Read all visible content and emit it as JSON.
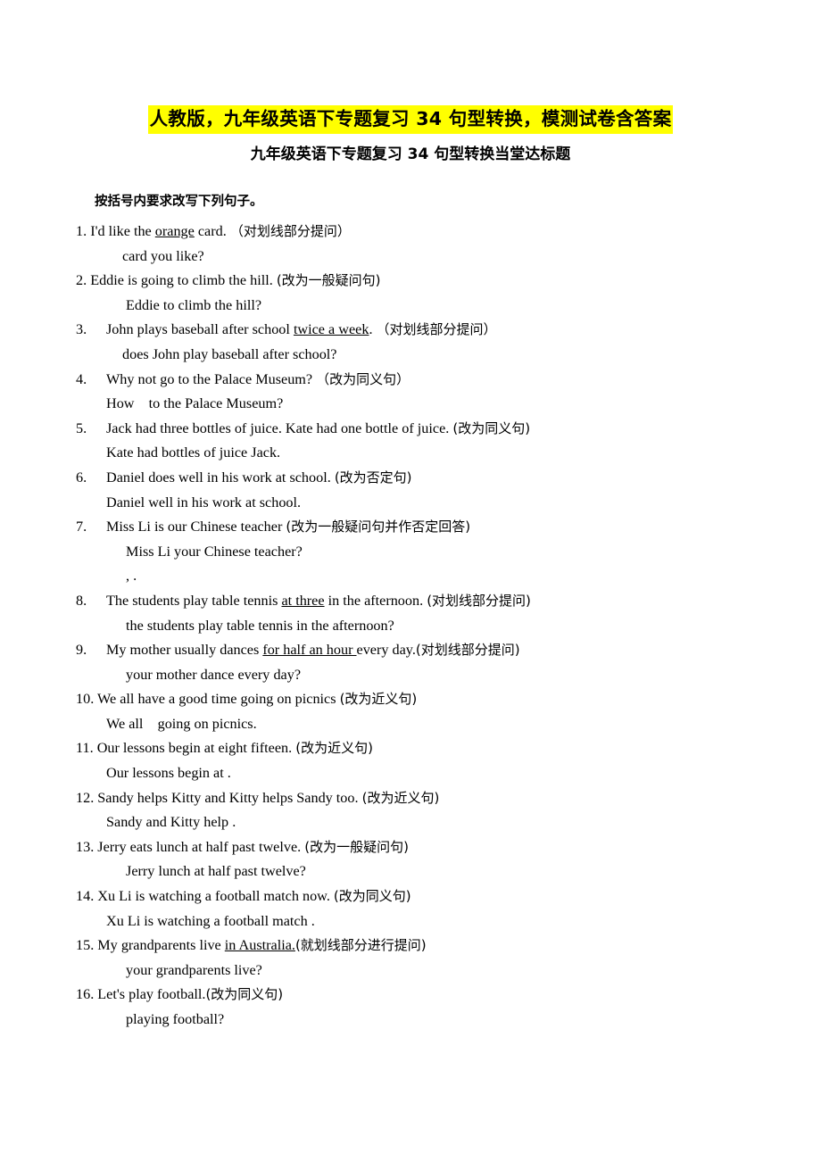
{
  "document": {
    "title": "人教版，九年级英语下专题复习 34 句型转换，模测试卷含答案",
    "title_highlight_color": "#ffff00",
    "subtitle": "九年级英语下专题复习 34 句型转换当堂达标题",
    "instruction": "按括号内要求改写下列句子。"
  },
  "questions": [
    {
      "number": "1.",
      "stem_pre": "I'd like the ",
      "stem_underlined": "orange",
      "stem_post": " card.",
      "stem_note": "（对划线部分提问）",
      "answer_parts": [
        "",
        "card",
        "you like?"
      ]
    },
    {
      "number": "2.",
      "stem_pre": "Eddie is going to climb the hill.",
      "stem_underlined": "",
      "stem_post": "",
      "stem_note": "(改为一般疑问句)",
      "answer_parts": [
        "Eddie",
        "to climb the hill?"
      ]
    },
    {
      "number": "3.",
      "stem_pre": "John plays baseball after school ",
      "stem_underlined": "twice a week",
      "stem_post": ".",
      "stem_note": "（对划线部分提问）",
      "answer_parts": [
        "does John play baseball after school?"
      ]
    },
    {
      "number": "4.",
      "stem_pre": "Why not go to the Palace Museum?",
      "stem_underlined": "",
      "stem_post": "",
      "stem_note": "（改为同义句）",
      "answer_parts": [
        "How",
        "to the Palace Museum?"
      ]
    },
    {
      "number": "5.",
      "stem_pre": "Jack had three bottles of juice. Kate had one bottle of juice.",
      "stem_underlined": "",
      "stem_post": "",
      "stem_note": "(改为同义句)",
      "answer_parts": [
        "Kate had",
        "bottles of juice",
        "Jack."
      ]
    },
    {
      "number": "6.",
      "stem_pre": "Daniel does well in his work at school.",
      "stem_underlined": "",
      "stem_post": "",
      "stem_note": "(改为否定句)",
      "answer_parts": [
        "Daniel",
        "well in his work at school."
      ]
    },
    {
      "number": "7.",
      "stem_pre": "Miss Li is our Chinese teacher ",
      "stem_underlined": "",
      "stem_post": "",
      "stem_note": "(改为一般疑问句并作否定回答)",
      "answer_parts": [
        "Miss Li your Chinese teacher?",
        ", ."
      ]
    },
    {
      "number": "8.",
      "stem_pre": "The students play table tennis ",
      "stem_underlined": "at three",
      "stem_post": " in the afternoon.",
      "stem_note": "(对划线部分提问)",
      "answer_parts": [
        "the students play table tennis in the afternoon?"
      ]
    },
    {
      "number": "9.",
      "stem_pre": "My mother usually dances ",
      "stem_underlined": "for half an hour ",
      "stem_post": "every day.",
      "stem_note": "(对划线部分提问)",
      "answer_parts": [
        "your mother dance every day?"
      ]
    },
    {
      "number": "10.",
      "stem_pre": "We all have a good time going on picnics ",
      "stem_underlined": "",
      "stem_post": "",
      "stem_note": "(改为近义句)",
      "answer_parts": [
        "We all",
        "going on picnics."
      ]
    },
    {
      "number": "11.",
      "stem_pre": "Our lessons begin at eight fifteen.",
      "stem_underlined": "",
      "stem_post": "",
      "stem_note": "(改为近义句)",
      "answer_parts": [
        "Our lessons begin at",
        "."
      ]
    },
    {
      "number": "12.",
      "stem_pre": "Sandy helps Kitty and Kitty helps Sandy too.",
      "stem_underlined": "",
      "stem_post": "",
      "stem_note": "(改为近义句)",
      "answer_parts": [
        "Sandy and Kitty help",
        "."
      ]
    },
    {
      "number": "13.",
      "stem_pre": "Jerry eats lunch at half past twelve.",
      "stem_underlined": "",
      "stem_post": "",
      "stem_note": "(改为一般疑问句)",
      "answer_parts": [
        "Jerry",
        "lunch at half past twelve?"
      ]
    },
    {
      "number": "14.",
      "stem_pre": "Xu Li is watching a football match now.",
      "stem_underlined": "",
      "stem_post": "",
      "stem_note": "(改为同义句)",
      "answer_parts": [
        "Xu Li is watching a football match",
        "."
      ]
    },
    {
      "number": "15.",
      "stem_pre": "My grandparents live ",
      "stem_underlined": "in Australia.",
      "stem_post": "",
      "stem_note": "(就划线部分进行提问)",
      "answer_parts": [
        "your grandparents live?"
      ]
    },
    {
      "number": "16.",
      "stem_pre": "Let's play football.",
      "stem_underlined": "",
      "stem_post": "",
      "stem_note": "(改为同义句)",
      "answer_parts": [
        "playing football?"
      ]
    }
  ],
  "lines": {
    "q1_stem_num": "1.",
    "q1_stem_a": "I'd like the ",
    "q1_stem_u": "orange",
    "q1_stem_b": " card.",
    "q1_stem_note": "（对划线部分提问）",
    "q1_ans_card": "card",
    "q1_ans_tail": "you like?",
    "q2_stem_num": "2.",
    "q2_stem_a": "Eddie is going to climb the hill.",
    "q2_stem_note": "(改为一般疑问句)",
    "q2_ans_mid": "Eddie",
    "q2_ans_tail": "to climb the hill?",
    "q3_stem_num": "3.",
    "q3_stem_a": "John plays baseball after school ",
    "q3_stem_u": "twice a week",
    "q3_stem_b": ".",
    "q3_stem_note": "（对划线部分提问）",
    "q3_ans_tail": "does John play baseball after school?",
    "q4_stem_num": "4.",
    "q4_stem_a": "Why not go to the Palace Museum?",
    "q4_stem_note": "（改为同义句）",
    "q4_ans_head": "How",
    "q4_ans_tail": "to the Palace Museum?",
    "q5_stem_num": "5.",
    "q5_stem_a": "Jack had three bottles of juice. Kate had one bottle of juice.",
    "q5_stem_note": "(改为同义句)",
    "q5_ans_head": "Kate had",
    "q5_ans_mid": "bottles of juice",
    "q5_ans_tail": "Jack.",
    "q6_stem_num": "6.",
    "q6_stem_a": "Daniel does well in his work at school.",
    "q6_stem_note": "(改为否定句)",
    "q6_ans_head": "Daniel",
    "q6_ans_tail": "well in his work at school.",
    "q7_stem_num": "7.",
    "q7_stem_a": "Miss Li is our Chinese teacher ",
    "q7_stem_note": "(改为一般疑问句并作否定回答)",
    "q7_ans_tail": "Miss Li your Chinese teacher?",
    "q7_ans2_comma": ",",
    "q7_ans2_period": ".",
    "q8_stem_num": "8.",
    "q8_stem_a": "The students play table tennis ",
    "q8_stem_u": "at three",
    "q8_stem_b": " in the afternoon.",
    "q8_stem_note": "(对划线部分提问)",
    "q8_ans_tail": "the students play table tennis in the afternoon?",
    "q9_stem_num": "9.",
    "q9_stem_a": "My mother usually dances ",
    "q9_stem_u": "for half an hour ",
    "q9_stem_b": "every day.",
    "q9_stem_note": "(对划线部分提问)",
    "q9_ans_tail": "your mother dance every day?",
    "q10_stem_num": "10.",
    "q10_stem_a": "We all have a good time going on picnics ",
    "q10_stem_note": "(改为近义句)",
    "q10_ans_head": "We all",
    "q10_ans_tail": "going on picnics.",
    "q11_stem_num": "11.",
    "q11_stem_a": "Our lessons begin at eight fifteen. ",
    "q11_stem_note": "(改为近义句)",
    "q11_ans_head": "Our lessons begin at",
    "q11_ans_tail": ".",
    "q12_stem_num": "12.",
    "q12_stem_a": "Sandy helps Kitty and Kitty helps Sandy too. ",
    "q12_stem_note": "(改为近义句)",
    "q12_ans_head": "Sandy and Kitty help",
    "q12_ans_tail": ".",
    "q13_stem_num": "13.",
    "q13_stem_a": "Jerry eats lunch at half past twelve. ",
    "q13_stem_note": "(改为一般疑问句)",
    "q13_ans_mid": "Jerry",
    "q13_ans_tail": "lunch at half past twelve?",
    "q14_stem_num": "14.",
    "q14_stem_a": "Xu Li is watching a football match now. ",
    "q14_stem_note": "(改为同义句)",
    "q14_ans_head": "Xu Li is watching a football match",
    "q14_ans_tail": ".",
    "q15_stem_num": "15.",
    "q15_stem_a": "My grandparents live ",
    "q15_stem_u": "in Australia.",
    "q15_stem_note": "(就划线部分进行提问)",
    "q15_ans_tail": "your grandparents live?",
    "q16_stem_num": "16.",
    "q16_stem_a": "Let's play football.",
    "q16_stem_note": "(改为同义句)",
    "q16_ans_tail": "playing football?"
  }
}
